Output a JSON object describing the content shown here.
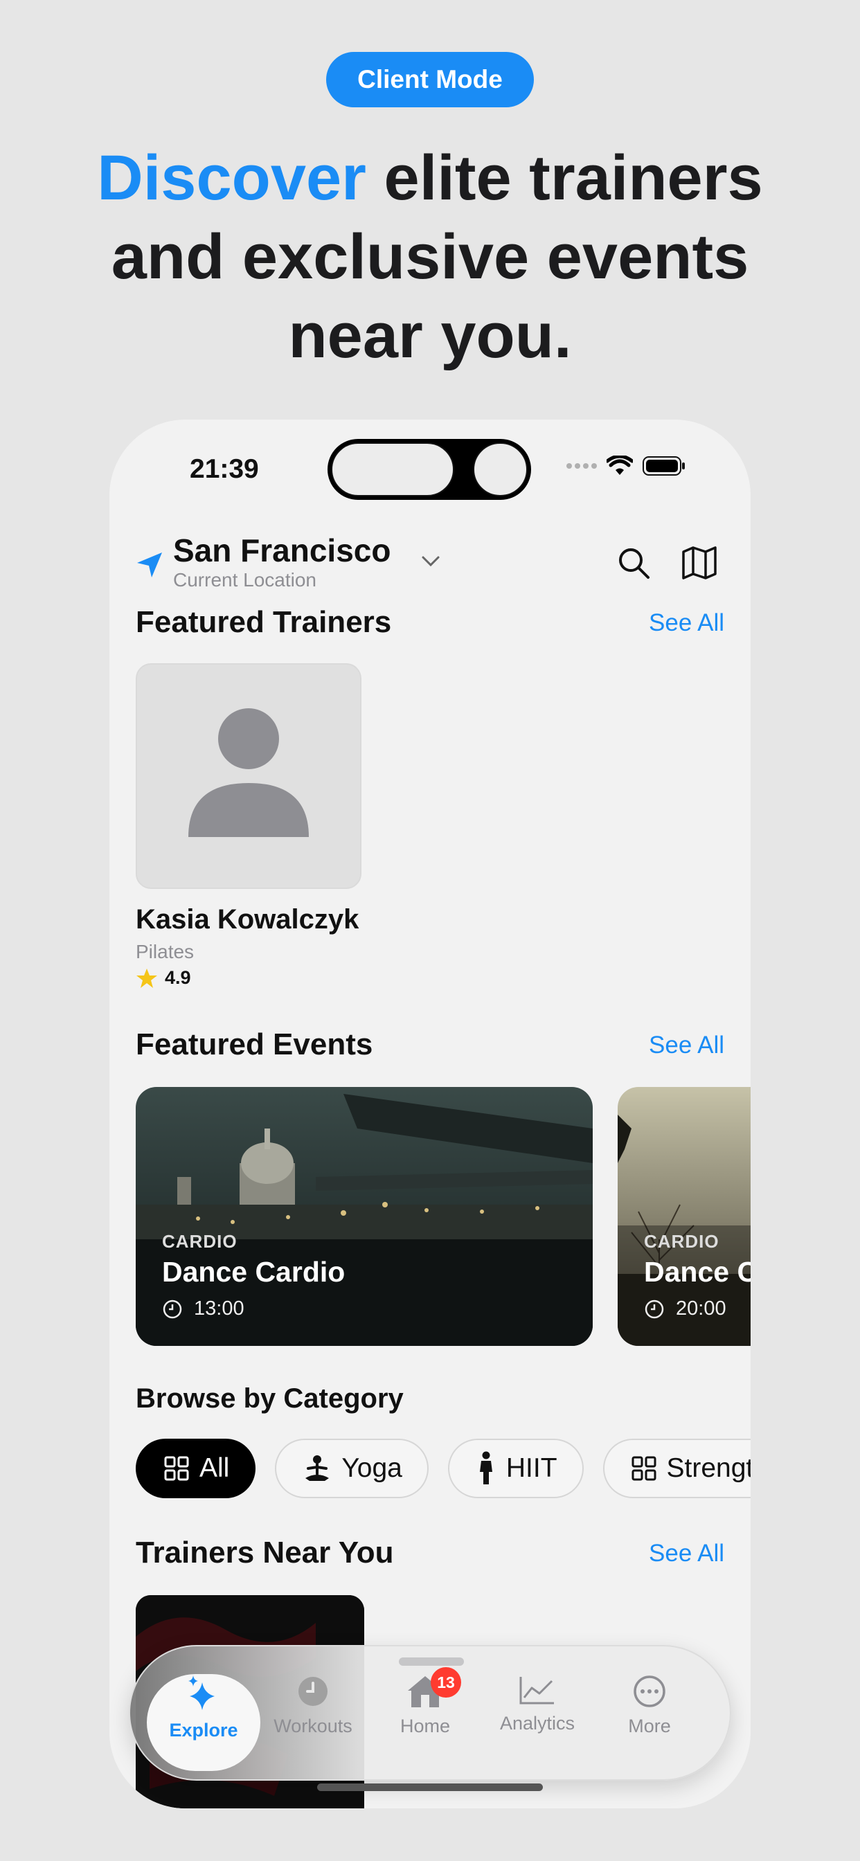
{
  "header": {
    "mode_pill": "Client Mode",
    "headline_accent": "Discover",
    "headline_line1_rest": " elite trainers",
    "headline_line2": "and exclusive events",
    "headline_line3": "near you."
  },
  "status_bar": {
    "time": "21:39"
  },
  "location": {
    "city": "San Francisco",
    "subtitle": "Current Location"
  },
  "featured_trainers": {
    "title": "Featured Trainers",
    "see_all": "See All",
    "items": [
      {
        "name": "Kasia Kowalczyk",
        "category": "Pilates",
        "rating": "4.9"
      }
    ]
  },
  "featured_events": {
    "title": "Featured Events",
    "see_all": "See All",
    "items": [
      {
        "category": "CARDIO",
        "title": "Dance Cardio",
        "time": "13:00"
      },
      {
        "category": "CARDIO",
        "title": "Dance Cardio",
        "time": "20:00"
      }
    ]
  },
  "categories": {
    "title": "Browse by Category",
    "items": [
      {
        "label": "All",
        "icon": "grid-icon",
        "active": true
      },
      {
        "label": "Yoga",
        "icon": "yoga-icon",
        "active": false
      },
      {
        "label": "HIIT",
        "icon": "person-icon",
        "active": false
      },
      {
        "label": "Strength",
        "icon": "grid-icon",
        "active": false
      }
    ]
  },
  "trainers_near": {
    "title": "Trainers Near You",
    "see_all": "See All"
  },
  "tabbar": {
    "tabs": [
      {
        "label": "Explore",
        "icon": "sparkles-icon",
        "active": true
      },
      {
        "label": "Workouts",
        "icon": "clock-icon",
        "active": false
      },
      {
        "label": "Home",
        "icon": "house-icon",
        "active": false,
        "badge": "13"
      },
      {
        "label": "Analytics",
        "icon": "chart-icon",
        "active": false
      },
      {
        "label": "More",
        "icon": "ellipsis-icon",
        "active": false
      }
    ]
  },
  "colors": {
    "accent": "#1a8cf5",
    "badge": "#ff3b30",
    "star": "#f5c518"
  }
}
